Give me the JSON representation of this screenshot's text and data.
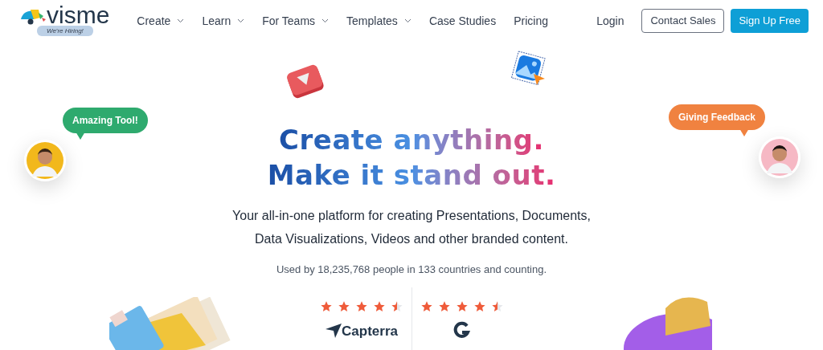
{
  "header": {
    "logo": "visme",
    "hiring_badge": "We're Hiring!",
    "nav": [
      {
        "label": "Create",
        "has_menu": true
      },
      {
        "label": "Learn",
        "has_menu": true
      },
      {
        "label": "For Teams",
        "has_menu": true
      },
      {
        "label": "Templates",
        "has_menu": true
      },
      {
        "label": "Case Studies",
        "has_menu": false
      },
      {
        "label": "Pricing",
        "has_menu": false
      }
    ],
    "login": "Login",
    "contact": "Contact Sales",
    "signup": "Sign Up Free"
  },
  "hero": {
    "headline": [
      "Create anything.",
      "Make it stand out."
    ],
    "subtitle": "Your all-in-one platform for creating Presentations, Documents, Data Visualizations, Videos and other branded content.",
    "usage": "Used by 18,235,768 people in 133 countries and counting."
  },
  "bubbles": [
    {
      "text": "Amazing Tool!",
      "color": "#2eaa6e"
    },
    {
      "text": "Giving Feedback",
      "color": "#f08240"
    }
  ],
  "ratings": [
    {
      "stars": 4.5,
      "brand": "Capterra",
      "kind": "capterra"
    },
    {
      "stars": 4.5,
      "kind": "g2"
    }
  ]
}
